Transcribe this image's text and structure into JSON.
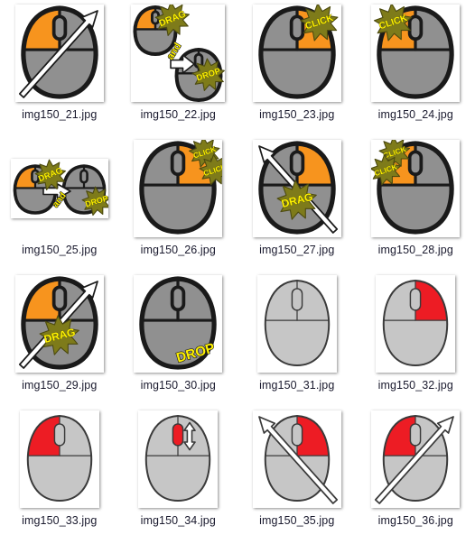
{
  "view": {
    "kind": "file-thumbnail-grid",
    "background_color": "#ffffff",
    "caption_color": "#1a1a2e",
    "columns": 4,
    "rows": 4
  },
  "palette": {
    "orange": "#F7941E",
    "red": "#ED1C24",
    "mouse_gray": "#909090",
    "mouse_gray_light": "#C6C6C6",
    "outline_dark": "#1A1A1A",
    "outline_light": "#3A3A3A",
    "burst_olive": "#7E7B1A",
    "burst_yellow": "#FFF200",
    "label_yellow": "#FFF200",
    "arrow_white": "#FFFFFF",
    "thumb_bg": "#FFFFFF"
  },
  "items": [
    {
      "filename": "img150_21.jpg",
      "style": "bold",
      "body": "#909090",
      "highlight_button": "left",
      "highlight_color": "#F7941E",
      "wheel_color": "#909090",
      "arrow": "up-right",
      "arrow_style": "single",
      "badges": [],
      "thumb_w": 98,
      "thumb_h": 108
    },
    {
      "filename": "img150_22.jpg",
      "style": "dual-diagonal",
      "body": "#909090",
      "highlight_button": "left",
      "highlight_color": "#F7941E",
      "wheel_color": "#909090",
      "arrow": "none",
      "arrow_style": "block-right",
      "badges": [
        "DRAG",
        "and",
        "DROP"
      ],
      "thumb_w": 104,
      "thumb_h": 108
    },
    {
      "filename": "img150_23.jpg",
      "style": "bold",
      "body": "#909090",
      "highlight_button": "right",
      "highlight_color": "#F7941E",
      "wheel_color": "#909090",
      "arrow": "none",
      "arrow_style": "none",
      "badges": [
        "CLICK"
      ],
      "thumb_w": 98,
      "thumb_h": 108
    },
    {
      "filename": "img150_24.jpg",
      "style": "bold",
      "body": "#909090",
      "highlight_button": "left",
      "highlight_color": "#F7941E",
      "wheel_color": "#909090",
      "arrow": "none",
      "arrow_style": "none",
      "badges": [
        "CLICK"
      ],
      "thumb_w": 98,
      "thumb_h": 108
    },
    {
      "filename": "img150_25.jpg",
      "style": "dual-horizontal",
      "body": "#909090",
      "highlight_button": "left",
      "highlight_color": "#F7941E",
      "wheel_color": "#909090",
      "arrow": "none",
      "arrow_style": "block-right",
      "badges": [
        "DRAG",
        "and",
        "DROP"
      ],
      "thumb_w": 108,
      "thumb_h": 66
    },
    {
      "filename": "img150_26.jpg",
      "style": "bold",
      "body": "#909090",
      "highlight_button": "right",
      "highlight_color": "#F7941E",
      "wheel_color": "#909090",
      "arrow": "none",
      "arrow_style": "none",
      "badges": [
        "CLICK",
        "CLICK"
      ],
      "thumb_w": 98,
      "thumb_h": 108
    },
    {
      "filename": "img150_27.jpg",
      "style": "bold",
      "body": "#909090",
      "highlight_button": "right",
      "highlight_color": "#F7941E",
      "wheel_color": "#909090",
      "arrow": "up-left",
      "arrow_style": "single",
      "badges": [
        "DRAG"
      ],
      "thumb_w": 98,
      "thumb_h": 108
    },
    {
      "filename": "img150_28.jpg",
      "style": "bold",
      "body": "#909090",
      "highlight_button": "left",
      "highlight_color": "#F7941E",
      "wheel_color": "#909090",
      "arrow": "none",
      "arrow_style": "none",
      "badges": [
        "CLICK",
        "CLICK"
      ],
      "thumb_w": 98,
      "thumb_h": 108
    },
    {
      "filename": "img150_29.jpg",
      "style": "bold",
      "body": "#909090",
      "highlight_button": "left",
      "highlight_color": "#F7941E",
      "wheel_color": "#909090",
      "arrow": "up-right",
      "arrow_style": "single",
      "badges": [
        "DRAG"
      ],
      "thumb_w": 98,
      "thumb_h": 108
    },
    {
      "filename": "img150_30.jpg",
      "style": "bold",
      "body": "#909090",
      "highlight_button": "none",
      "highlight_color": "#909090",
      "wheel_color": "#909090",
      "arrow": "none",
      "arrow_style": "none",
      "badges": [
        "DROP"
      ],
      "thumb_w": 98,
      "thumb_h": 108
    },
    {
      "filename": "img150_31.jpg",
      "style": "light",
      "body": "#C6C6C6",
      "highlight_button": "none",
      "highlight_color": "#C6C6C6",
      "wheel_color": "#C6C6C6",
      "arrow": "none",
      "arrow_style": "none",
      "badges": [],
      "thumb_w": 88,
      "thumb_h": 108
    },
    {
      "filename": "img150_32.jpg",
      "style": "light",
      "body": "#C6C6C6",
      "highlight_button": "right",
      "highlight_color": "#ED1C24",
      "wheel_color": "#C6C6C6",
      "arrow": "none",
      "arrow_style": "none",
      "badges": [],
      "thumb_w": 88,
      "thumb_h": 108
    },
    {
      "filename": "img150_33.jpg",
      "style": "light",
      "body": "#C6C6C6",
      "highlight_button": "left",
      "highlight_color": "#ED1C24",
      "wheel_color": "#C6C6C6",
      "arrow": "none",
      "arrow_style": "none",
      "badges": [],
      "thumb_w": 88,
      "thumb_h": 108
    },
    {
      "filename": "img150_34.jpg",
      "style": "light",
      "body": "#C6C6C6",
      "highlight_button": "none",
      "highlight_color": "#C6C6C6",
      "wheel_color": "#ED1C24",
      "arrow": "none",
      "arrow_style": "scroll-updown",
      "badges": [],
      "thumb_w": 88,
      "thumb_h": 108
    },
    {
      "filename": "img150_35.jpg",
      "style": "light",
      "body": "#C6C6C6",
      "highlight_button": "right",
      "highlight_color": "#ED1C24",
      "wheel_color": "#C6C6C6",
      "arrow": "up-left",
      "arrow_style": "single",
      "badges": [],
      "thumb_w": 98,
      "thumb_h": 108
    },
    {
      "filename": "img150_36.jpg",
      "style": "light",
      "body": "#C6C6C6",
      "highlight_button": "left",
      "highlight_color": "#ED1C24",
      "wheel_color": "#C6C6C6",
      "arrow": "up-right",
      "arrow_style": "single",
      "badges": [],
      "thumb_w": 98,
      "thumb_h": 108
    }
  ]
}
